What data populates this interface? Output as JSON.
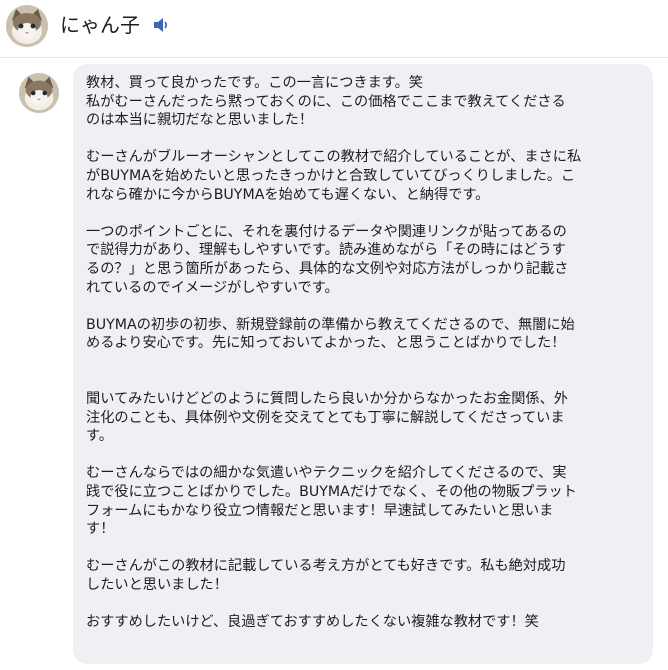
{
  "header": {
    "user_name": "にゃん子",
    "avatar_icon": "cat-avatar-icon",
    "audio_icon": "speaker-icon"
  },
  "message": {
    "avatar_icon": "cat-avatar-icon",
    "paragraphs": [
      "教材、買って良かったです。この一言につきます。笑\n私がむーさんだったら黙っておくのに、この価格でここまで教えてくださる\nのは本当に親切だなと思いました！",
      "むーさんがブルーオーシャンとしてこの教材で紹介していることが、まさに私\nがBUYMAを始めたいと思ったきっかけと合致していてびっくりしました。こ\nれなら確かに今からBUYMAを始めても遅くない、と納得です。",
      "一つのポイントごとに、それを裏付けるデータや関連リンクが貼ってあるの\nで説得力があり、理解もしやすいです。読み進めながら「その時にはどうす\nるの？」と思う箇所があったら、具体的な文例や対応方法がしっかり記載さ\nれているのでイメージがしやすいです。",
      "BUYMAの初歩の初歩、新規登録前の準備から教えてくださるので、無闇に始\nめるより安心です。先に知っておいてよかった、と思うことばかりでした！",
      "聞いてみたいけどどのように質問したら良いか分からなかったお金関係、外\n注化のことも、具体例や文例を交えてとても丁寧に解説してくださっていま\nす。",
      "むーさんならではの細かな気遣いやテクニックを紹介してくださるので、実\n践で役に立つことばかりでした。BUYMAだけでなく、その他の物販プラット\nフォームにもかなり役立つ情報だと思います！早速試してみたいと思いま\nす！",
      "むーさんがこの教材に記載している考え方がとても好きです。私も絶対成功\nしたいと思いました！",
      "おすすめしたいけど、良過ぎておすすめしたくない複雑な教材です！笑"
    ]
  },
  "colors": {
    "bubble_bg": "#eef0f4",
    "text": "#1c1e21",
    "divider": "#e4e6eb",
    "icon": "#4267b2"
  }
}
